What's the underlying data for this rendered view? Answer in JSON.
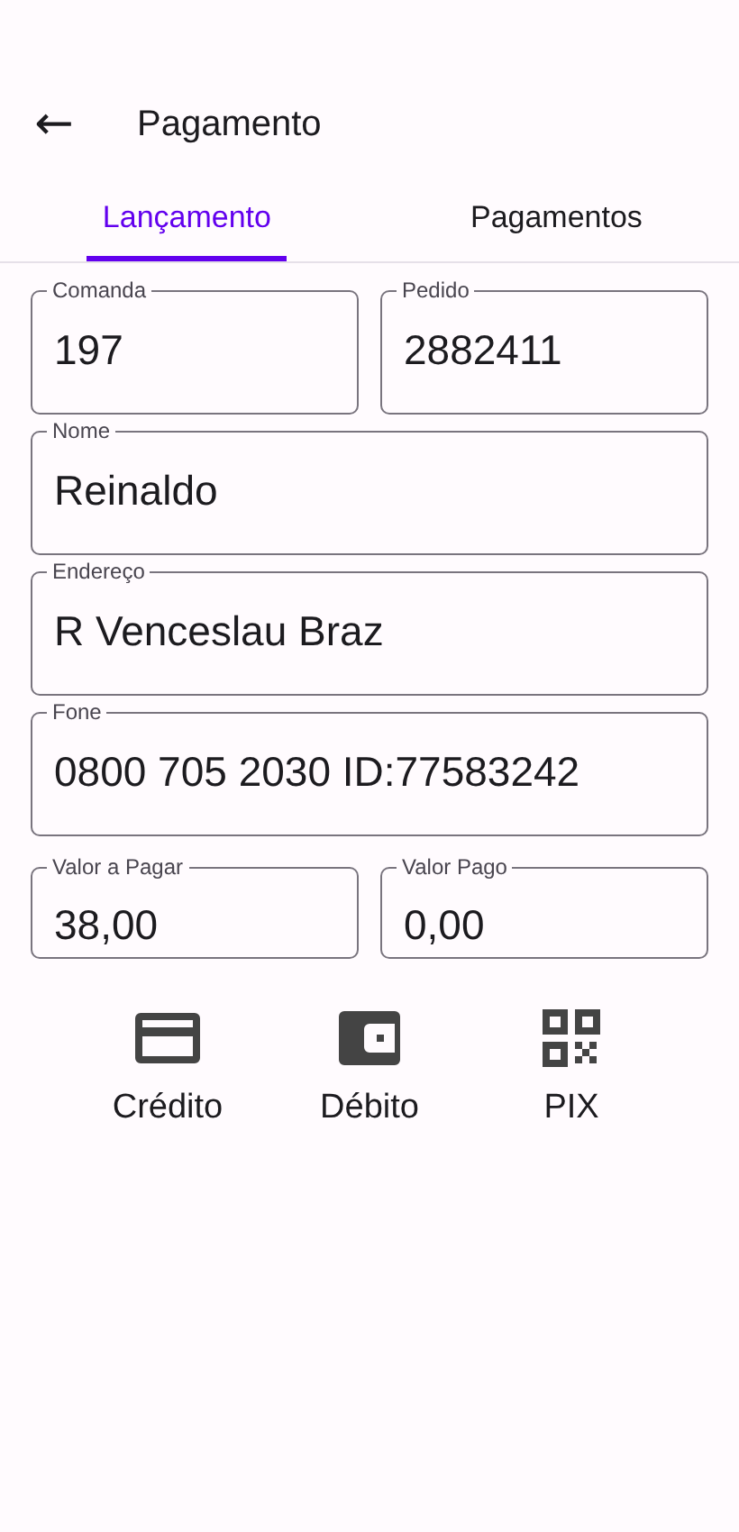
{
  "app_bar": {
    "back_icon": "←",
    "title": "Pagamento"
  },
  "tabs": [
    {
      "label": "Lançamento",
      "selected": true
    },
    {
      "label": "Pagamentos",
      "selected": false
    }
  ],
  "form_rows": [
    [
      {
        "label": "Comanda",
        "value": "197"
      },
      {
        "label": "Pedido",
        "value": "2882411"
      }
    ],
    [
      {
        "label": "Nome",
        "value": "Reinaldo"
      }
    ],
    [
      {
        "label": "Endereço",
        "value": "R Venceslau Braz"
      }
    ],
    [
      {
        "label": "Fone",
        "value": "0800 705 2030 ID:77583242"
      }
    ],
    [
      {
        "label": "Valor a Pagar",
        "value": "38,00"
      },
      {
        "label": "Valor Pago",
        "value": "0,00"
      }
    ]
  ],
  "payment_methods": [
    {
      "kind": "card",
      "label": "Crédito"
    },
    {
      "kind": "wallet",
      "label": "Débito"
    },
    {
      "kind": "qr",
      "label": "PIX"
    }
  ]
}
